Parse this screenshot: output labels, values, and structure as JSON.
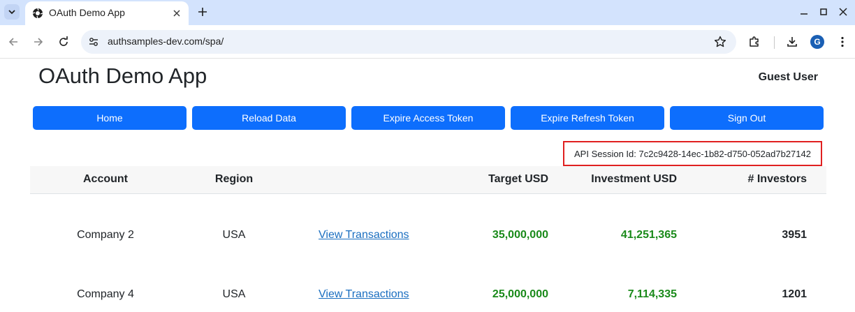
{
  "browser": {
    "tab_title": "OAuth Demo App",
    "url": "authsamples-dev.com/spa/",
    "profile_initial": "G"
  },
  "app": {
    "title": "OAuth Demo App",
    "user": "Guest User"
  },
  "buttons": {
    "home": "Home",
    "reload": "Reload Data",
    "expire_access": "Expire Access Token",
    "expire_refresh": "Expire Refresh Token",
    "sign_out": "Sign Out"
  },
  "session": {
    "label": "API Session Id: 7c2c9428-14ec-1b82-d750-052ad7b27142"
  },
  "table": {
    "headers": {
      "account": "Account",
      "region": "Region",
      "target": "Target USD",
      "investment": "Investment USD",
      "investors": "# Investors"
    },
    "rows": [
      {
        "account": "Company 2",
        "region": "USA",
        "link": "View Transactions",
        "target": "35,000,000",
        "investment": "41,251,365",
        "investors": "3951"
      },
      {
        "account": "Company 4",
        "region": "USA",
        "link": "View Transactions",
        "target": "25,000,000",
        "investment": "7,114,335",
        "investors": "1201"
      }
    ]
  },
  "colors": {
    "primary_button": "#0d6efd",
    "highlight_border": "#e02020",
    "positive_value": "#1a8a1a",
    "link": "#1a6ec0"
  }
}
